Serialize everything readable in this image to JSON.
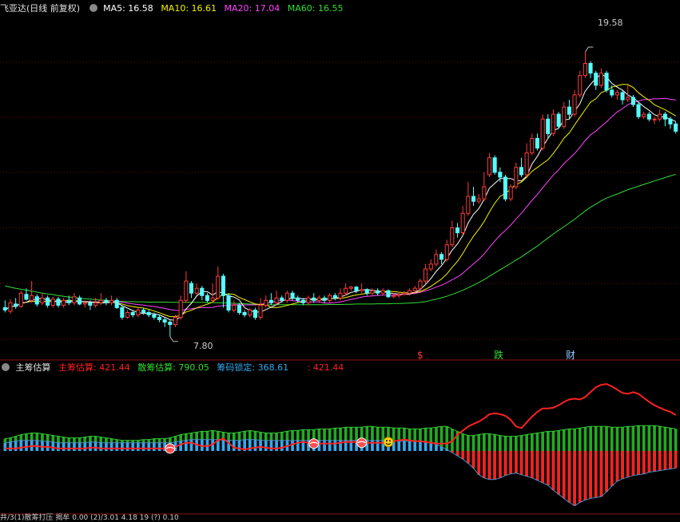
{
  "main_panel": {
    "title": "飞亚达(日线 前复权)",
    "ma5_label": "MA5: 16.58",
    "ma10_label": "MA10: 16.61",
    "ma20_label": "MA20: 17.04",
    "ma60_label": "MA60: 16.55",
    "high_label": "19.58",
    "low_label": "7.80",
    "events": [
      "$",
      "跌",
      "财"
    ]
  },
  "sub_panel": {
    "title": "主筹估算",
    "main_label": "主筹估算: 421.44",
    "retail_label": "散筹估算: 790.05",
    "lock_label": "筹码锁定: 368.61",
    "extra_label": ": 421.44"
  },
  "bottom_strip": {
    "text": "井/3(1)散筹打压 揭牟 0.00   (2)/3.01   4.18   19   (?)   0.10"
  },
  "colors": {
    "up": "#ff3a3a",
    "down": "#54ffff",
    "ma5": "#ffffff",
    "ma10": "#f2f200",
    "ma20": "#ff44ff",
    "ma60": "#33dd33",
    "main": "#ff2020",
    "retail": "#33aaee",
    "lock": "#22aa22",
    "grid": "#6a1010"
  },
  "chart_data": {
    "type": "candlestick",
    "ylim": [
      7,
      21
    ],
    "high": 19.58,
    "low": 7.8,
    "candles": [
      [
        9.0,
        8.9,
        9.3,
        8.8
      ],
      [
        8.85,
        9.2,
        9.35,
        8.75
      ],
      [
        9.15,
        9.05,
        9.4,
        8.95
      ],
      [
        9.05,
        9.6,
        9.7,
        9.0
      ],
      [
        9.55,
        9.35,
        9.8,
        9.3
      ],
      [
        9.3,
        9.5,
        10.1,
        9.2
      ],
      [
        9.45,
        9.15,
        9.55,
        9.05
      ],
      [
        9.2,
        9.4,
        9.6,
        9.1
      ],
      [
        9.4,
        9.1,
        9.5,
        9.0
      ],
      [
        9.1,
        9.35,
        9.45,
        9.0
      ],
      [
        9.35,
        9.1,
        9.45,
        9.0
      ],
      [
        9.1,
        9.3,
        9.4,
        9.0
      ],
      [
        9.3,
        9.2,
        9.5,
        9.1
      ],
      [
        9.2,
        9.45,
        9.6,
        9.1
      ],
      [
        9.4,
        9.15,
        9.5,
        9.1
      ],
      [
        9.15,
        9.2,
        9.3,
        9.0
      ],
      [
        9.2,
        9.1,
        9.3,
        8.9
      ],
      [
        9.1,
        9.2,
        9.4,
        9.0
      ],
      [
        9.2,
        9.3,
        9.6,
        9.1
      ],
      [
        9.3,
        9.2,
        9.4,
        9.1
      ],
      [
        9.2,
        9.3,
        9.5,
        9.1
      ],
      [
        9.3,
        9.0,
        9.4,
        8.95
      ],
      [
        9.0,
        8.6,
        9.1,
        8.5
      ],
      [
        8.6,
        8.8,
        8.9,
        8.55
      ],
      [
        8.8,
        8.7,
        8.9,
        8.6
      ],
      [
        8.7,
        8.9,
        9.0,
        8.6
      ],
      [
        8.9,
        8.8,
        9.0,
        8.7
      ],
      [
        8.8,
        8.7,
        8.9,
        8.6
      ],
      [
        8.7,
        8.6,
        8.8,
        8.5
      ],
      [
        8.6,
        8.5,
        8.7,
        8.4
      ],
      [
        8.5,
        8.4,
        8.6,
        8.2
      ],
      [
        8.4,
        8.3,
        8.5,
        7.8
      ],
      [
        8.3,
        8.6,
        8.7,
        8.2
      ],
      [
        8.6,
        9.3,
        9.5,
        8.5
      ],
      [
        9.3,
        10.1,
        10.5,
        9.2
      ],
      [
        10.0,
        9.6,
        10.1,
        9.4
      ],
      [
        9.6,
        9.8,
        10.0,
        9.5
      ],
      [
        9.8,
        9.5,
        9.9,
        9.3
      ],
      [
        9.5,
        9.3,
        9.6,
        9.2
      ],
      [
        9.3,
        9.4,
        10.0,
        9.2
      ],
      [
        9.4,
        10.3,
        10.7,
        9.3
      ],
      [
        10.3,
        9.5,
        10.4,
        9.0
      ],
      [
        9.5,
        8.9,
        9.6,
        8.8
      ],
      [
        8.9,
        9.1,
        9.3,
        8.8
      ],
      [
        9.1,
        8.8,
        9.2,
        8.7
      ],
      [
        8.8,
        8.7,
        8.9,
        8.6
      ],
      [
        8.7,
        8.9,
        9.0,
        8.6
      ],
      [
        8.9,
        8.6,
        9.0,
        8.5
      ],
      [
        8.6,
        9.1,
        9.4,
        8.5
      ],
      [
        9.1,
        9.3,
        9.5,
        9.0
      ],
      [
        9.3,
        9.2,
        9.6,
        9.1
      ],
      [
        9.2,
        9.4,
        9.7,
        9.1
      ],
      [
        9.4,
        9.3,
        9.5,
        9.2
      ],
      [
        9.3,
        9.6,
        9.7,
        9.2
      ],
      [
        9.6,
        9.4,
        9.7,
        9.3
      ],
      [
        9.4,
        9.3,
        9.5,
        9.2
      ],
      [
        9.3,
        9.2,
        9.4,
        9.1
      ],
      [
        9.2,
        9.4,
        9.5,
        9.1
      ],
      [
        9.4,
        9.3,
        9.6,
        9.2
      ],
      [
        9.3,
        9.4,
        9.5,
        9.2
      ],
      [
        9.4,
        9.3,
        9.5,
        9.2
      ],
      [
        9.3,
        9.5,
        9.6,
        9.2
      ],
      [
        9.5,
        9.4,
        9.6,
        9.3
      ],
      [
        9.4,
        9.6,
        9.8,
        9.3
      ],
      [
        9.6,
        9.8,
        10.0,
        9.5
      ],
      [
        9.8,
        9.85,
        9.9,
        9.7
      ],
      [
        9.85,
        9.7,
        9.9,
        9.6
      ],
      [
        9.7,
        9.75,
        10.0,
        9.6
      ],
      [
        9.75,
        9.6,
        9.8,
        9.5
      ],
      [
        9.6,
        9.7,
        9.8,
        9.5
      ],
      [
        9.7,
        9.6,
        9.8,
        9.5
      ],
      [
        9.6,
        9.7,
        9.8,
        9.5
      ],
      [
        9.7,
        9.45,
        9.75,
        9.4
      ],
      [
        9.45,
        9.5,
        9.6,
        9.4
      ],
      [
        9.5,
        9.55,
        9.65,
        9.4
      ],
      [
        9.55,
        9.6,
        9.7,
        9.5
      ],
      [
        9.6,
        9.7,
        9.8,
        9.5
      ],
      [
        9.7,
        9.8,
        9.9,
        9.6
      ],
      [
        9.8,
        10.1,
        10.2,
        9.7
      ],
      [
        10.1,
        10.6,
        10.8,
        10.0
      ],
      [
        10.6,
        10.8,
        11.0,
        10.5
      ],
      [
        10.8,
        11.2,
        11.4,
        10.7
      ],
      [
        11.2,
        11.0,
        11.3,
        10.8
      ],
      [
        11.0,
        11.6,
        11.8,
        10.9
      ],
      [
        11.6,
        12.3,
        12.6,
        11.5
      ],
      [
        12.3,
        12.1,
        12.5,
        11.9
      ],
      [
        12.1,
        12.9,
        13.2,
        12.0
      ],
      [
        12.9,
        13.6,
        14.2,
        12.8
      ],
      [
        13.6,
        13.4,
        14.0,
        13.2
      ],
      [
        13.4,
        13.5,
        13.7,
        13.3
      ],
      [
        13.5,
        14.0,
        14.6,
        13.4
      ],
      [
        14.5,
        15.2,
        15.4,
        14.4
      ],
      [
        15.2,
        14.6,
        15.3,
        14.5
      ],
      [
        14.6,
        14.4,
        14.8,
        14.2
      ],
      [
        14.4,
        13.5,
        14.5,
        13.4
      ],
      [
        13.5,
        14.0,
        14.1,
        13.4
      ],
      [
        14.0,
        14.8,
        15.0,
        13.9
      ],
      [
        14.8,
        14.5,
        15.2,
        14.4
      ],
      [
        14.5,
        15.4,
        15.8,
        14.4
      ],
      [
        15.4,
        16.0,
        16.2,
        15.3
      ],
      [
        16.0,
        15.6,
        16.2,
        15.5
      ],
      [
        15.6,
        16.8,
        17.0,
        15.5
      ],
      [
        16.8,
        16.2,
        17.0,
        16.0
      ],
      [
        16.2,
        17.0,
        17.2,
        16.1
      ],
      [
        17.0,
        16.5,
        17.1,
        16.4
      ],
      [
        16.5,
        17.3,
        17.5,
        16.4
      ],
      [
        17.3,
        17.0,
        17.6,
        16.8
      ],
      [
        17.0,
        17.8,
        18.0,
        16.9
      ],
      [
        17.8,
        18.6,
        18.8,
        17.7
      ],
      [
        18.6,
        19.1,
        19.58,
        18.5
      ],
      [
        19.1,
        18.7,
        19.2,
        18.5
      ],
      [
        18.7,
        18.2,
        18.8,
        18.0
      ],
      [
        18.2,
        18.7,
        18.9,
        18.1
      ],
      [
        18.7,
        18.0,
        18.8,
        17.9
      ],
      [
        18.0,
        17.8,
        18.2,
        17.7
      ],
      [
        17.8,
        17.9,
        18.0,
        17.6
      ],
      [
        17.9,
        17.6,
        18.0,
        17.4
      ],
      [
        17.6,
        17.7,
        18.2,
        17.5
      ],
      [
        17.7,
        17.4,
        17.8,
        17.3
      ],
      [
        17.4,
        16.9,
        17.5,
        16.8
      ],
      [
        16.9,
        17.0,
        17.1,
        16.8
      ],
      [
        17.0,
        16.8,
        17.1,
        16.7
      ],
      [
        16.8,
        16.8,
        16.9,
        16.6
      ],
      [
        16.8,
        17.0,
        17.2,
        16.7
      ],
      [
        17.0,
        16.8,
        17.1,
        16.5
      ],
      [
        16.8,
        16.6,
        16.9,
        16.4
      ],
      [
        16.6,
        16.3,
        16.7,
        16.2
      ]
    ],
    "series": [
      {
        "name": "MA5",
        "values": []
      },
      {
        "name": "MA10",
        "values": []
      },
      {
        "name": "MA20",
        "values": []
      },
      {
        "name": "MA60",
        "values": [
          9.9,
          9.85,
          9.8,
          9.76,
          9.72,
          9.68,
          9.64,
          9.6,
          9.57,
          9.54,
          9.5,
          9.47,
          9.44,
          9.42,
          9.39,
          9.37,
          9.35,
          9.33,
          9.31,
          9.3,
          9.28,
          9.27,
          9.26,
          9.25,
          9.25,
          9.24,
          9.24,
          9.23,
          9.23,
          9.23,
          9.23,
          9.22,
          9.22,
          9.22,
          9.22,
          9.22,
          9.22,
          9.22,
          9.21,
          9.21,
          9.2,
          9.2,
          9.19,
          9.18,
          9.17,
          9.16,
          9.15,
          9.14,
          9.13,
          9.12,
          9.12,
          9.12,
          9.12,
          9.12,
          9.12,
          9.12,
          9.12,
          9.12,
          9.12,
          9.12,
          9.12,
          9.13,
          9.13,
          9.13,
          9.14,
          9.14,
          9.15,
          9.15,
          9.15,
          9.15,
          9.16,
          9.16,
          9.16,
          9.17,
          9.17,
          9.18,
          9.19,
          9.2,
          9.22,
          9.25,
          9.3,
          9.35,
          9.41,
          9.47,
          9.55,
          9.63,
          9.72,
          9.82,
          9.93,
          10.04,
          10.16,
          10.3,
          10.43,
          10.57,
          10.7,
          10.83,
          10.97,
          11.1,
          11.25,
          11.4,
          11.55,
          11.72,
          11.88,
          12.05,
          12.2,
          12.35,
          12.5,
          12.66,
          12.83,
          13.0,
          13.15,
          13.28,
          13.42,
          13.53,
          13.62,
          13.7,
          13.79,
          13.88,
          13.95,
          14.02,
          14.1,
          14.17,
          14.24,
          14.31,
          14.38,
          14.45,
          14.52
        ]
      }
    ],
    "sub_series": {
      "ylim": [
        -8,
        9
      ],
      "lock": [
        1.5,
        1.6,
        1.8,
        2.0,
        2.1,
        2.2,
        2.2,
        2.1,
        2.0,
        1.9,
        1.8,
        1.7,
        1.6,
        1.6,
        1.6,
        1.7,
        1.8,
        1.8,
        1.7,
        1.6,
        1.5,
        1.4,
        1.3,
        1.3,
        1.3,
        1.3,
        1.4,
        1.4,
        1.5,
        1.5,
        1.5,
        1.6,
        1.8,
        2.0,
        2.1,
        2.2,
        2.3,
        2.4,
        2.4,
        2.5,
        2.4,
        2.3,
        2.2,
        2.2,
        2.3,
        2.4,
        2.5,
        2.4,
        2.3,
        2.2,
        2.2,
        2.2,
        2.3,
        2.4,
        2.5,
        2.5,
        2.6,
        2.6,
        2.6,
        2.7,
        2.7,
        2.7,
        2.8,
        2.8,
        2.9,
        2.9,
        2.9,
        2.9,
        3.0,
        3.0,
        2.9,
        2.9,
        2.9,
        2.8,
        2.8,
        2.8,
        2.7,
        2.7,
        2.7,
        2.8,
        2.8,
        2.9,
        3.0,
        3.0,
        2.7,
        2.4,
        2.1,
        1.9,
        1.9,
        2.0,
        2.1,
        2.1,
        2.0,
        1.9,
        1.8,
        1.8,
        1.8,
        1.9,
        2.0,
        2.1,
        2.2,
        2.3,
        2.4,
        2.4,
        2.5,
        2.6,
        2.7,
        2.7,
        2.8,
        2.9,
        3.0,
        3.0,
        3.0,
        3.0,
        2.9,
        2.9,
        2.9,
        3.0,
        3.0,
        3.1,
        3.1,
        3.1,
        3.1,
        3.0,
        2.9,
        2.8,
        2.7
      ],
      "base": [
        1.0,
        1.1,
        1.2,
        1.3,
        1.3,
        1.3,
        1.3,
        1.2,
        1.2,
        1.1,
        1.0,
        1.0,
        1.0,
        1.0,
        1.0,
        1.0,
        1.1,
        1.1,
        1.0,
        1.0,
        1.0,
        1.0,
        1.0,
        1.0,
        1.0,
        1.0,
        1.0,
        1.0,
        1.0,
        1.0,
        1.0,
        1.0,
        1.1,
        1.2,
        1.3,
        1.4,
        1.4,
        1.4,
        1.4,
        1.4,
        1.4,
        1.3,
        1.3,
        1.3,
        1.3,
        1.4,
        1.4,
        1.4,
        1.3,
        1.3,
        1.3,
        1.3,
        1.3,
        1.3,
        1.3,
        1.3,
        1.3,
        1.3,
        1.3,
        1.3,
        1.3,
        1.3,
        1.3,
        1.3,
        1.3,
        1.3,
        1.3,
        1.3,
        1.3,
        1.3,
        1.3,
        1.3,
        1.3,
        1.2,
        1.2,
        1.2,
        1.2,
        1.2,
        1.2,
        1.1,
        1.0,
        0.8,
        0.5,
        0.2,
        -0.2,
        -0.6,
        -1.0,
        -1.5,
        -2.1,
        -2.9,
        -3.3,
        -3.5,
        -3.5,
        -3.3,
        -3.0,
        -2.8,
        -2.7,
        -2.9,
        -3.1,
        -3.3,
        -3.6,
        -3.9,
        -4.2,
        -4.8,
        -5.3,
        -5.8,
        -6.3,
        -6.7,
        -6.3,
        -6.0,
        -5.8,
        -5.7,
        -5.6,
        -5.0,
        -4.3,
        -3.7,
        -3.4,
        -3.2,
        -3.0,
        -2.9,
        -2.8,
        -2.6,
        -2.5,
        -2.4,
        -2.3,
        -2.2,
        -2.1
      ],
      "main_line": [
        0.3,
        0.3,
        0.3,
        0.4,
        0.5,
        0.6,
        0.6,
        0.5,
        0.5,
        0.4,
        0.3,
        0.3,
        0.3,
        0.3,
        0.3,
        0.3,
        0.4,
        0.4,
        0.3,
        0.3,
        0.3,
        0.3,
        0.3,
        0.3,
        0.3,
        0.3,
        0.3,
        0.3,
        0.3,
        0.3,
        0.3,
        0.3,
        0.5,
        0.8,
        1.0,
        1.0,
        0.8,
        0.6,
        0.6,
        0.8,
        1.3,
        1.5,
        1.0,
        0.4,
        0.3,
        0.2,
        0.3,
        0.4,
        0.5,
        0.4,
        0.3,
        0.3,
        0.4,
        0.6,
        0.8,
        1.0,
        1.1,
        1.0,
        0.9,
        0.9,
        0.9,
        0.9,
        0.9,
        1.0,
        1.1,
        1.1,
        1.1,
        1.0,
        1.0,
        1.0,
        1.0,
        1.0,
        1.1,
        1.2,
        1.3,
        1.4,
        1.3,
        1.2,
        1.2,
        1.1,
        1.0,
        0.9,
        0.9,
        0.9,
        1.2,
        2.0,
        2.5,
        3.0,
        3.3,
        3.6,
        4.0,
        4.5,
        4.6,
        4.5,
        4.3,
        3.8,
        3.0,
        2.8,
        3.5,
        4.2,
        4.8,
        5.2,
        5.2,
        5.3,
        5.6,
        6.0,
        6.3,
        6.4,
        6.3,
        6.6,
        7.2,
        7.8,
        8.1,
        8.2,
        7.9,
        7.5,
        7.1,
        7.0,
        7.2,
        7.0,
        6.5,
        6.0,
        5.6,
        5.3,
        5.0,
        4.8,
        4.4
      ],
      "markers": [
        31,
        58,
        67,
        72
      ]
    }
  }
}
